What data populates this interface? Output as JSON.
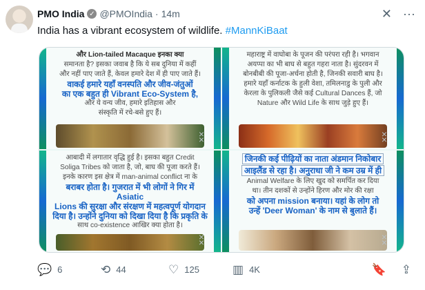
{
  "post": {
    "author": "PMO India",
    "handle": "@PMOIndia",
    "separator": "·",
    "time": "14m",
    "text": "India has a vibrant ecosystem of wildlife.",
    "hashtag": "#MannKiBaat"
  },
  "panels": [
    {
      "lines": [
        "और Lion-tailed Macaque इनका क्या",
        "समानता है? इसका जवाब है कि ये सब दुनिया में कहीं",
        "और नहीं पाए जाते हैं, केवल हमारे देश में ही पाए जाते हैं।",
        "वाकई हमारे यहाँ वनस्पति और जीव-जंतुओं",
        "का एक बहुत ही Vibrant Eco-System है,",
        "और ये वन्य जीव, हमारे इतिहास और",
        "संस्कृति में रचे-बसे हुए हैं।"
      ]
    },
    {
      "lines": [
        "महाराष्ट्र में वाघोबा के पूजन की परंपरा रही है। भगवान",
        "अयप्पा का भी बाघ से बहुत गहरा नाता है। सुंदरवन में",
        "बोनबीबी की पूजा-अर्चना होती है, जिनकी सवारी बाघ है।",
        "हमारे यहाँ कर्नाटक के हुली वेशा, तमिलनाडु के पुली और",
        "केरला के पुलिकली जैसे कई Cultural Dances हैं, जो",
        "Nature और Wild Life के साथ जुड़े हुए हैं।"
      ]
    },
    {
      "lines": [
        "आबादी में लगातार वृद्धि हुई है। इसका बहुत Credit",
        "Soliga Tribes को जाता है, जो, बाघ की पूजा करते हैं।",
        "इनके कारण इस क्षेत्र में man-animal conflict ना के",
        "बराबर होता है। गुजरात में भी लोगों ने गिर में Asiatic",
        "Lions की सुरक्षा और संरक्षण में महत्वपूर्ण योगदान",
        "दिया है। उन्होंने दुनिया को दिखा दिया है कि प्रकृति के",
        "साथ co-existence आखिर क्या होता है।"
      ]
    },
    {
      "lines": [
        "जिनकी कई पीढ़ियों का नाता अंडमान निकोबार",
        "आइलैंड से रहा है। अनुराधा जी ने कम उम्र में ही",
        "Animal Welfare के लिए खुद को समर्पित कर दिया",
        "था। तीन दशकों से उन्होंने हिरण और मोर की रक्षा",
        "को अपना mission बनाया। यहां के लोग तो",
        "उन्हें 'Deer Woman' के नाम से बुलाते हैं।"
      ]
    }
  ],
  "actions": {
    "replies": "6",
    "reposts": "44",
    "likes": "125",
    "views": "4K"
  },
  "icons": {
    "verified": "badge-check-icon",
    "grok": "grok-icon",
    "more": "more-icon",
    "reply": "reply-icon",
    "repost": "repost-icon",
    "like": "heart-icon",
    "views": "views-icon",
    "bookmark": "bookmark-icon",
    "share": "share-icon"
  },
  "colors": {
    "link": "#1d9bf0",
    "muted": "#536471",
    "highlight": "#1762c4"
  }
}
